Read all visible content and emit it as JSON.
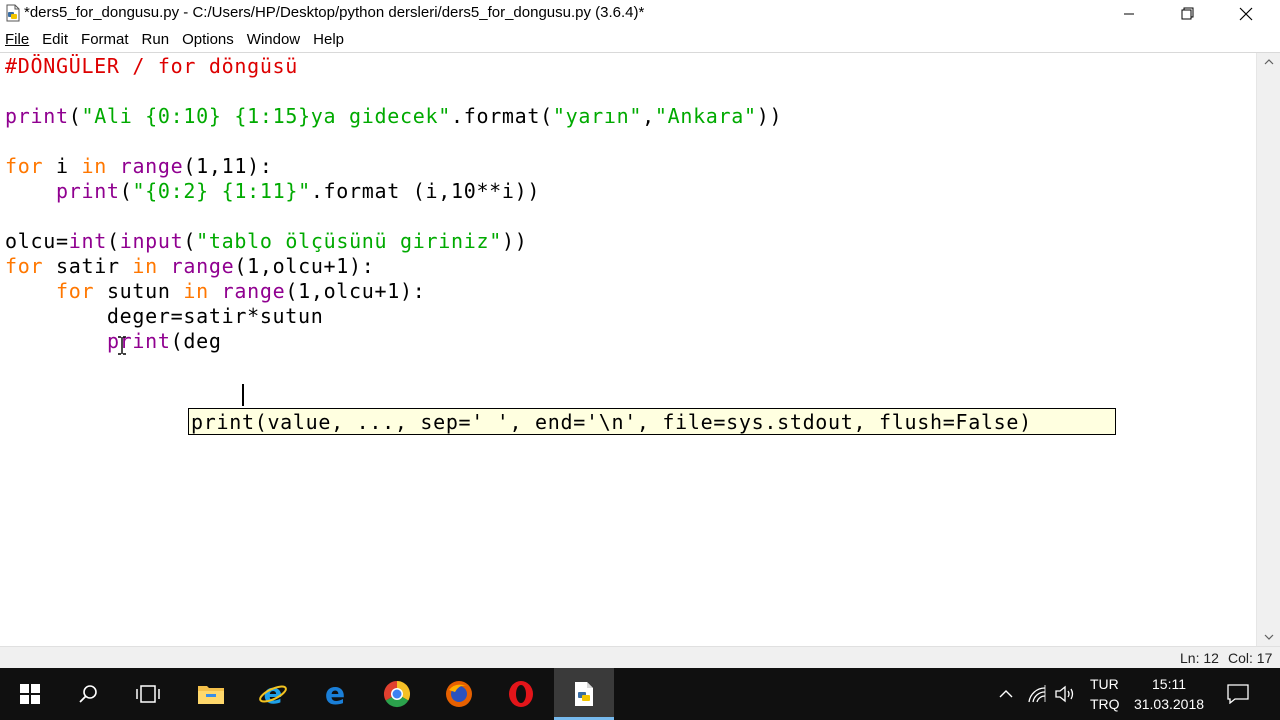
{
  "window": {
    "title": "*ders5_for_dongusu.py - C:/Users/HP/Desktop/python dersleri/ders5_for_dongusu.py (3.6.4)*"
  },
  "menu": {
    "file": "File",
    "edit": "Edit",
    "format": "Format",
    "run": "Run",
    "options": "Options",
    "window": "Window",
    "help": "Help"
  },
  "editor": {
    "lines": [
      [
        {
          "t": "#DÖNGÜLER / for döngüsü",
          "c": "cm"
        }
      ],
      [],
      [
        {
          "t": "print",
          "c": "bi"
        },
        {
          "t": "(",
          "c": "tx"
        },
        {
          "t": "\"Ali {0:10} {1:15}ya gidecek\"",
          "c": "str"
        },
        {
          "t": ".format(",
          "c": "tx"
        },
        {
          "t": "\"yarın\"",
          "c": "str"
        },
        {
          "t": ",",
          "c": "tx"
        },
        {
          "t": "\"Ankara\"",
          "c": "str"
        },
        {
          "t": "))",
          "c": "tx"
        }
      ],
      [],
      [
        {
          "t": "for",
          "c": "kw"
        },
        {
          "t": " i ",
          "c": "tx"
        },
        {
          "t": "in",
          "c": "kw"
        },
        {
          "t": " ",
          "c": "tx"
        },
        {
          "t": "range",
          "c": "bi"
        },
        {
          "t": "(1,11):",
          "c": "tx"
        }
      ],
      [
        {
          "t": "    ",
          "c": "tx"
        },
        {
          "t": "print",
          "c": "bi"
        },
        {
          "t": "(",
          "c": "tx"
        },
        {
          "t": "\"{0:2} {1:11}\"",
          "c": "str"
        },
        {
          "t": ".format (i,10**i))",
          "c": "tx"
        }
      ],
      [],
      [
        {
          "t": "olcu=",
          "c": "tx"
        },
        {
          "t": "int",
          "c": "bi"
        },
        {
          "t": "(",
          "c": "tx"
        },
        {
          "t": "input",
          "c": "bi"
        },
        {
          "t": "(",
          "c": "tx"
        },
        {
          "t": "\"tablo ölçüsünü giriniz\"",
          "c": "str"
        },
        {
          "t": "))",
          "c": "tx"
        }
      ],
      [
        {
          "t": "for",
          "c": "kw"
        },
        {
          "t": " satir ",
          "c": "tx"
        },
        {
          "t": "in",
          "c": "kw"
        },
        {
          "t": " ",
          "c": "tx"
        },
        {
          "t": "range",
          "c": "bi"
        },
        {
          "t": "(1,olcu+1):",
          "c": "tx"
        }
      ],
      [
        {
          "t": "    ",
          "c": "tx"
        },
        {
          "t": "for",
          "c": "kw"
        },
        {
          "t": " sutun ",
          "c": "tx"
        },
        {
          "t": "in",
          "c": "kw"
        },
        {
          "t": " ",
          "c": "tx"
        },
        {
          "t": "range",
          "c": "bi"
        },
        {
          "t": "(1,olcu+1):",
          "c": "tx"
        }
      ],
      [
        {
          "t": "        deger=satir*sutun",
          "c": "tx"
        }
      ],
      [
        {
          "t": "        ",
          "c": "tx"
        },
        {
          "t": "print",
          "c": "bi"
        },
        {
          "t": "(deg",
          "c": "tx"
        }
      ]
    ],
    "calltip": "print(value, ..., sep=' ', end='\\n', file=sys.stdout, flush=False)"
  },
  "status": {
    "ln": "Ln: 12",
    "col": "Col: 17"
  },
  "taskbar": {
    "lang_top": "TUR",
    "lang_bottom": "TRQ",
    "time": "15:11",
    "date": "31.03.2018",
    "accent": "#76b9ed"
  }
}
